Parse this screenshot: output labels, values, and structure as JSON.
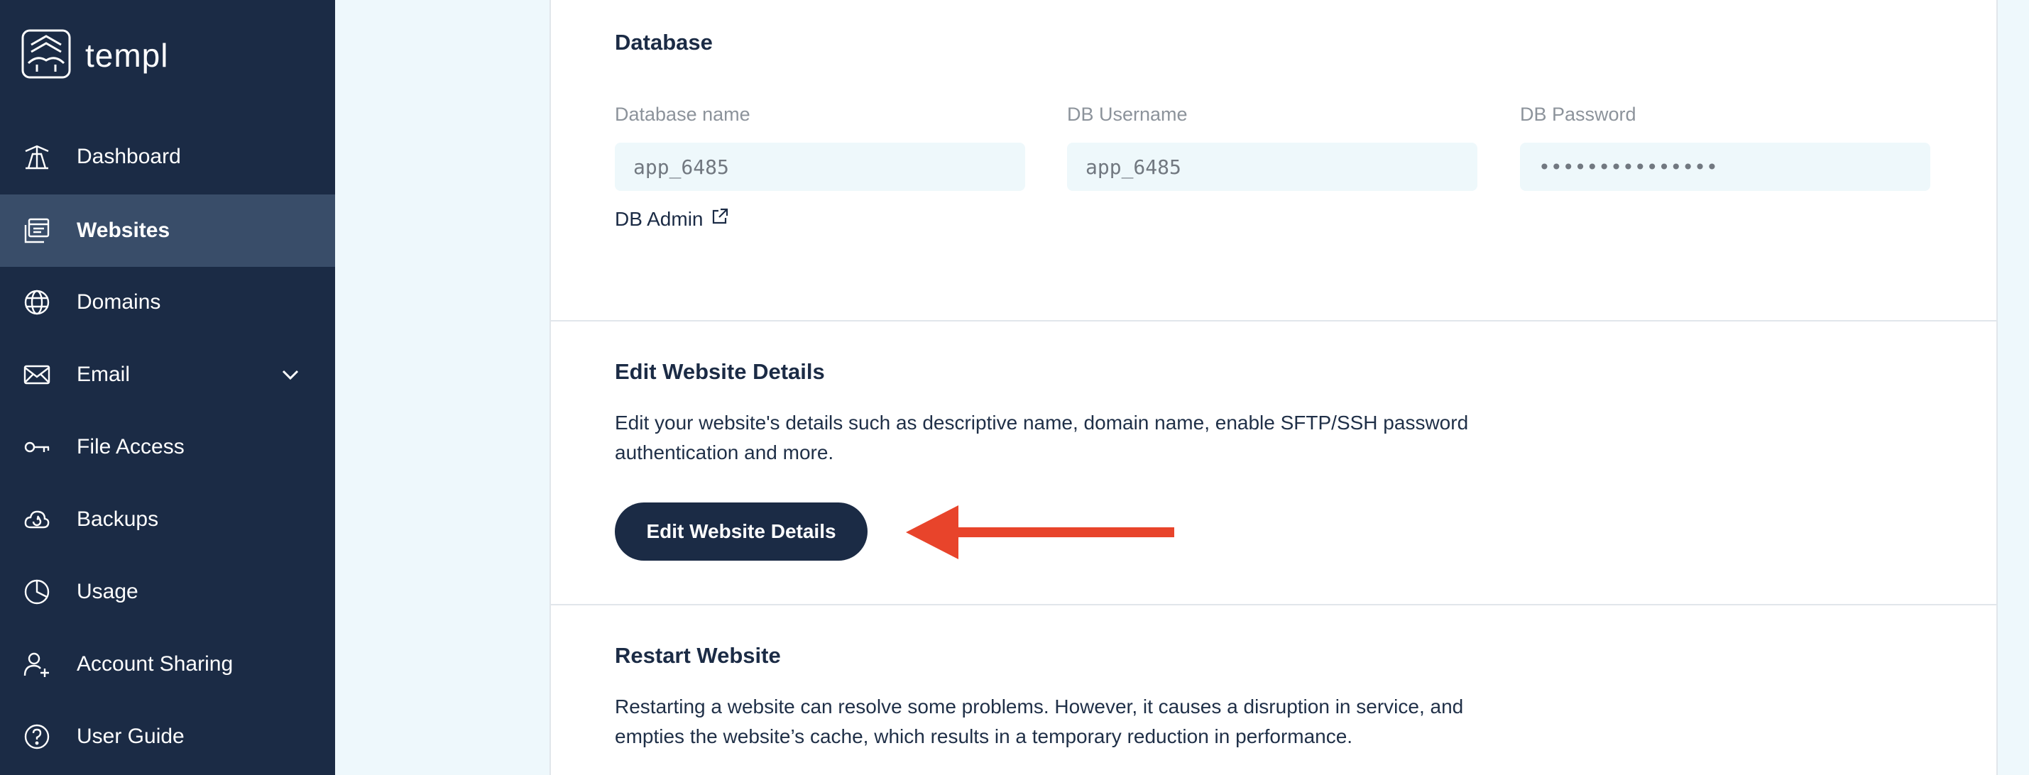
{
  "brand": {
    "name": "templ"
  },
  "sidebar": {
    "items": [
      {
        "label": "Dashboard",
        "icon": "dashboard-icon"
      },
      {
        "label": "Websites",
        "icon": "websites-icon",
        "active": true
      },
      {
        "label": "Domains",
        "icon": "globe-www-icon"
      },
      {
        "label": "Email",
        "icon": "envelope-icon",
        "has_dropdown": true
      },
      {
        "label": "File Access",
        "icon": "key-icon"
      },
      {
        "label": "Backups",
        "icon": "cloud-backup-icon"
      },
      {
        "label": "Usage",
        "icon": "pie-chart-icon"
      },
      {
        "label": "Account Sharing",
        "icon": "user-plus-icon"
      },
      {
        "label": "User Guide",
        "icon": "question-circle-icon"
      }
    ]
  },
  "database": {
    "title": "Database",
    "name_label": "Database name",
    "name_value": "app_6485",
    "user_label": "DB Username",
    "user_value": "app_6485",
    "password_label": "DB Password",
    "password_value": "•••••••••••••••",
    "admin_link": "DB Admin"
  },
  "edit_details": {
    "title": "Edit Website Details",
    "description": "Edit your website's details such as descriptive name, domain name, enable SFTP/SSH password authentication and more.",
    "button_label": "Edit Website Details"
  },
  "restart": {
    "title": "Restart Website",
    "description": "Restarting a website can resolve some problems. However, it causes a disruption in service, and empties the website’s cache, which results in a temporary reduction in performance."
  },
  "colors": {
    "sidebar_bg": "#1b2b45",
    "sidebar_active": "#394d69",
    "page_bg": "#eef8fc",
    "field_bg": "#eef8fb",
    "button_bg": "#1b2b45",
    "annotation_arrow": "#e8442b"
  }
}
